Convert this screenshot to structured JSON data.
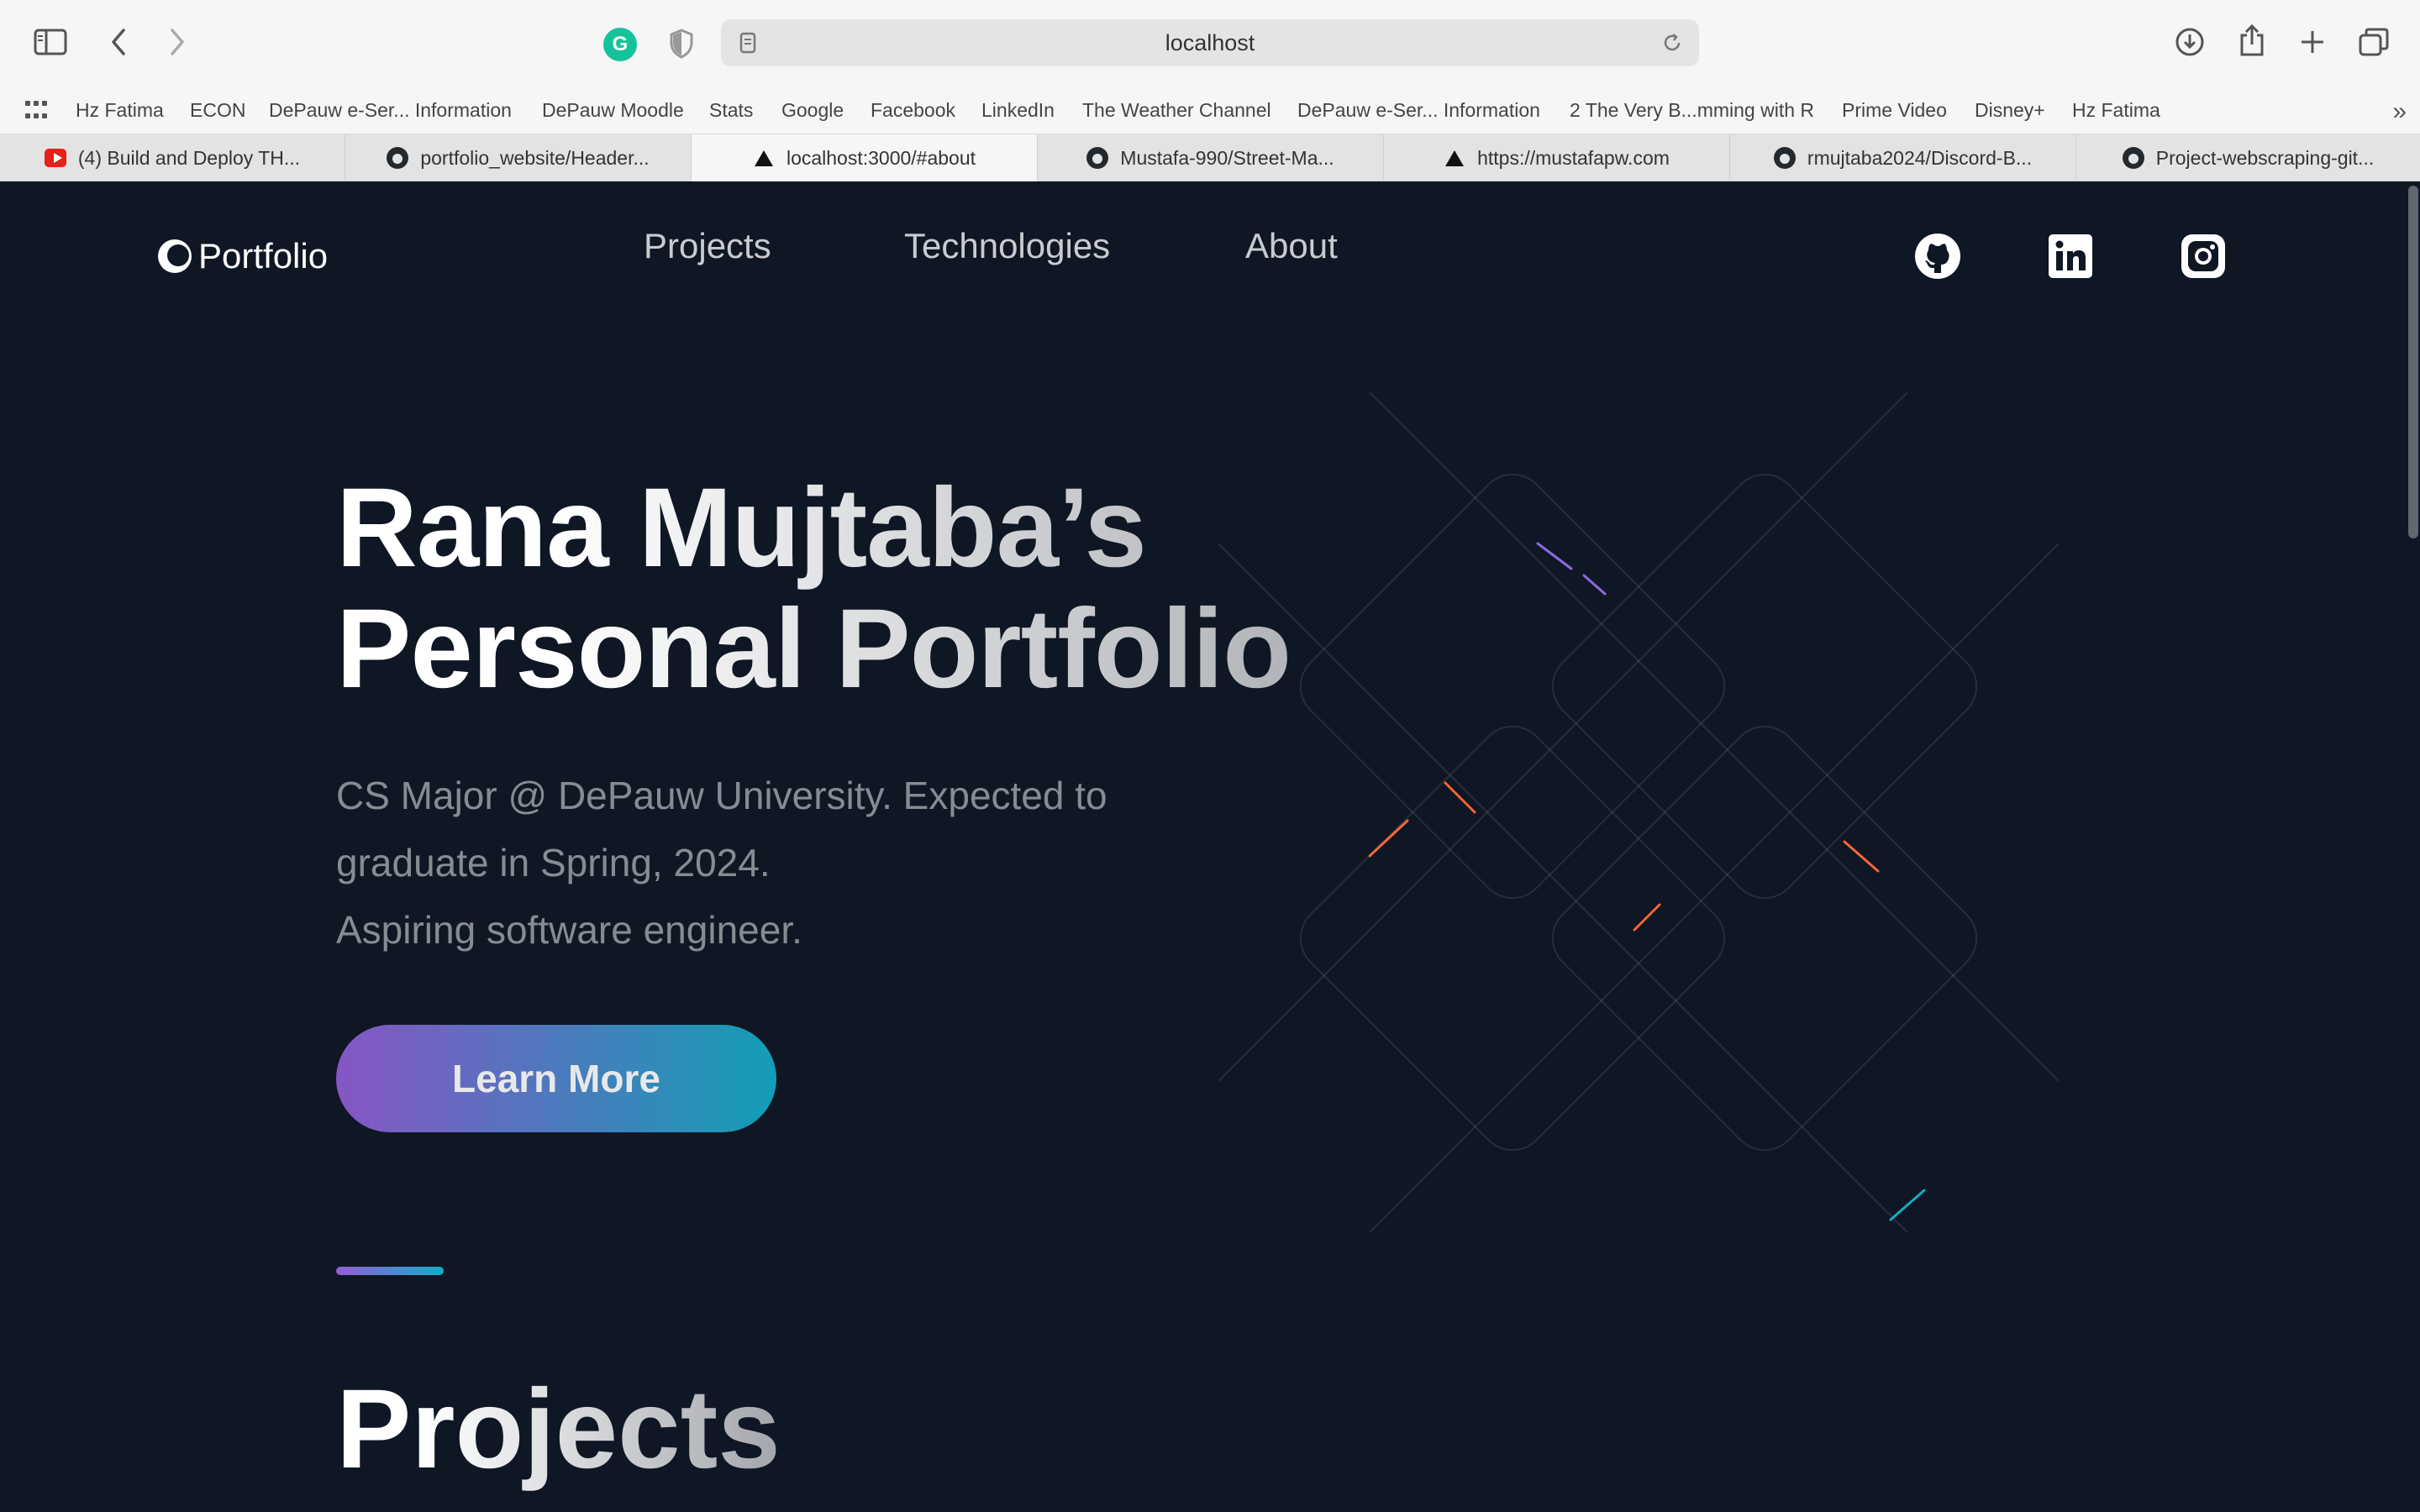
{
  "browser": {
    "address": "localhost",
    "bookmarks": [
      "Hz Fatima",
      "ECON",
      "DePauw e-Ser... Information",
      "DePauw Moodle",
      "Stats",
      "Google",
      "Facebook",
      "LinkedIn",
      "The Weather Channel",
      "DePauw e-Ser... Information",
      "2 The Very B...mming with R",
      "Prime Video",
      "Disney+",
      "Hz Fatima"
    ],
    "tabs": [
      {
        "label": "(4) Build and Deploy TH...",
        "icon": "youtube-icon"
      },
      {
        "label": "portfolio_website/Header...",
        "icon": "github-icon"
      },
      {
        "label": "localhost:3000/#about",
        "icon": "vercel-icon",
        "active": true
      },
      {
        "label": "Mustafa-990/Street-Ma...",
        "icon": "github-icon"
      },
      {
        "label": "https://mustafapw.com",
        "icon": "vercel-icon"
      },
      {
        "label": "rmujtaba2024/Discord-B...",
        "icon": "github-icon"
      },
      {
        "label": "Project-webscraping-git...",
        "icon": "github-icon"
      }
    ]
  },
  "header": {
    "logo": "Portfolio",
    "nav": [
      "Projects",
      "Technologies",
      "About"
    ],
    "social": [
      "github-icon",
      "linkedin-icon",
      "instagram-icon"
    ]
  },
  "hero": {
    "title_line1": "Rana Mujtaba’s",
    "title_line2": "Personal Portfolio",
    "subtitle_line1": "CS Major @ DePauw University. Expected to",
    "subtitle_line2": "graduate in Spring, 2024.",
    "subtitle_line3": "Aspiring software engineer.",
    "button": "Learn More"
  },
  "projects": {
    "title": "Projects"
  },
  "colors": {
    "page_bg": "#0f1624",
    "gradient_start": "#945dd6",
    "gradient_end": "#13adc7"
  }
}
